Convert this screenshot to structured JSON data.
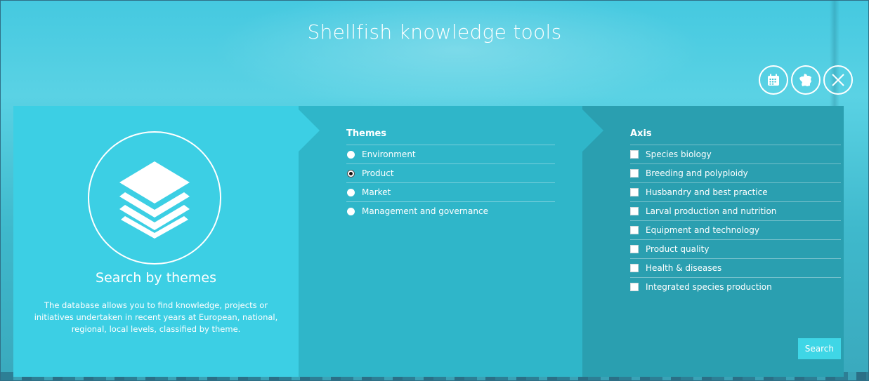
{
  "header": {
    "title": "Shellfish knowledge tools",
    "icons": [
      "calendar-icon",
      "france-map-icon",
      "close-icon"
    ]
  },
  "left_panel": {
    "icon": "layers-icon",
    "title": "Search by themes",
    "description": "The database allows you to find knowledge, projects or initiatives undertaken in recent years at European, national, regional, local levels, classified by theme."
  },
  "themes": {
    "title": "Themes",
    "options": [
      {
        "label": "Environment",
        "checked": false
      },
      {
        "label": "Product",
        "checked": true
      },
      {
        "label": "Market",
        "checked": false
      },
      {
        "label": "Management and governance",
        "checked": false
      }
    ]
  },
  "axis": {
    "title": "Axis",
    "options": [
      {
        "label": "Species biology",
        "checked": false
      },
      {
        "label": "Breeding and polyploidy",
        "checked": false
      },
      {
        "label": "Husbandry and best practice",
        "checked": false
      },
      {
        "label": "Larval production and nutrition",
        "checked": false
      },
      {
        "label": "Equipment and technology",
        "checked": false
      },
      {
        "label": "Product quality",
        "checked": false
      },
      {
        "label": "Health & diseases",
        "checked": false
      },
      {
        "label": "Integrated species production",
        "checked": false
      }
    ],
    "search_label": "Search"
  },
  "colors": {
    "left_panel": "#3ccfe4",
    "mid_panel": "#2fb6c9",
    "right_panel": "#2a9fb0",
    "search_button": "#3fd6e6"
  }
}
